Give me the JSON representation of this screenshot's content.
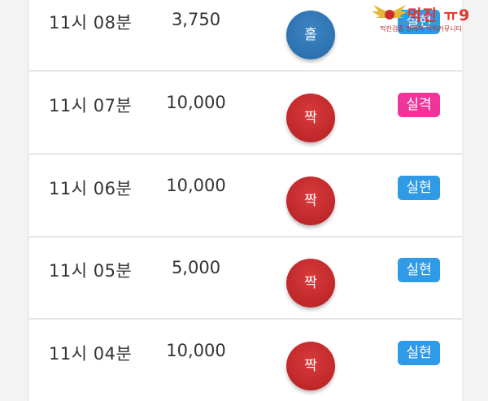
{
  "rows": [
    {
      "time": "11시 08분",
      "amount": "3,750",
      "result": "홀",
      "status": "실현"
    },
    {
      "time": "11시 07분",
      "amount": "10,000",
      "result": "짝",
      "status": "실격"
    },
    {
      "time": "11시 06분",
      "amount": "10,000",
      "result": "짝",
      "status": "실현"
    },
    {
      "time": "11시 05분",
      "amount": "5,000",
      "result": "짝",
      "status": "실현"
    },
    {
      "time": "11시 04분",
      "amount": "10,000",
      "result": "짝",
      "status": "실현"
    }
  ],
  "watermark": {
    "title": "먹진 ㅠ9",
    "subtitle": "먹진검증 명예의 먹튀커뮤니티"
  },
  "colors": {
    "odd_ball": "#2468a8",
    "even_ball": "#b41e22",
    "status_hit": "#2f9ae6",
    "status_miss": "#f0359a"
  }
}
